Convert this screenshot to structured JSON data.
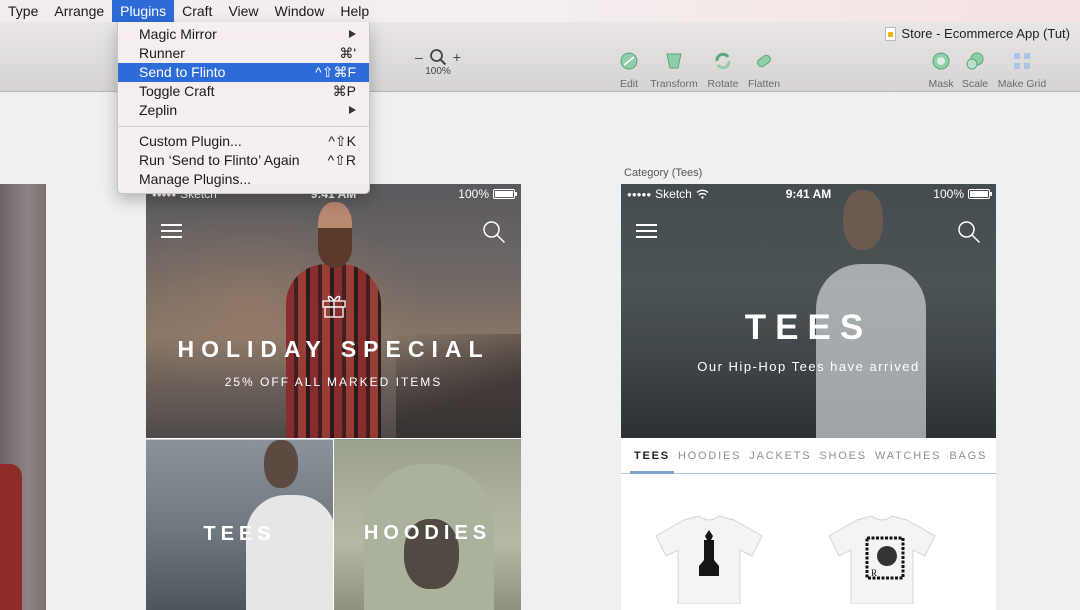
{
  "menubar": {
    "items": [
      {
        "label": "Type"
      },
      {
        "label": "Arrange"
      },
      {
        "label": "Plugins",
        "active": true
      },
      {
        "label": "Craft"
      },
      {
        "label": "View"
      },
      {
        "label": "Window"
      },
      {
        "label": "Help"
      }
    ]
  },
  "plugins_menu": {
    "items": [
      {
        "label": "Magic Mirror",
        "shortcut": "",
        "submenu": true
      },
      {
        "label": "Runner",
        "shortcut": "⌘'",
        "submenu": false
      },
      {
        "label": "Send to Flinto",
        "shortcut": "^⇧⌘F",
        "submenu": false,
        "highlighted": true
      },
      {
        "label": "Toggle Craft",
        "shortcut": "⌘P",
        "submenu": false
      },
      {
        "label": "Zeplin",
        "shortcut": "",
        "submenu": true
      }
    ],
    "items2": [
      {
        "label": "Custom Plugin...",
        "shortcut": "^⇧K"
      },
      {
        "label": "Run ‘Send to Flinto’ Again",
        "shortcut": "^⇧R"
      },
      {
        "label": "Manage Plugins...",
        "shortcut": ""
      }
    ]
  },
  "toolbar": {
    "document_title": "Store - Ecommerce App (Tut)",
    "zoom": {
      "minus": "–",
      "plus": "+",
      "level": "100%"
    },
    "tools": [
      {
        "label": "Edit",
        "icon": "edit-icon"
      },
      {
        "label": "Transform",
        "icon": "transform-icon"
      },
      {
        "label": "Rotate",
        "icon": "rotate-icon"
      },
      {
        "label": "Flatten",
        "icon": "flatten-icon"
      }
    ],
    "tools_right": [
      {
        "label": "Mask",
        "icon": "mask-icon"
      },
      {
        "label": "Scale",
        "icon": "scale-icon"
      },
      {
        "label": "Make Grid",
        "icon": "make-grid-icon"
      }
    ]
  },
  "colors": {
    "menu_highlight": "#2d6bd9",
    "tool_icon": "#7fc49a",
    "tab_underline": "#7fa3cc"
  },
  "home_artboard": {
    "status": {
      "carrier": "Sketch",
      "time": "9:41 AM",
      "battery": "100%"
    },
    "hero": {
      "title": "HOLIDAY SPECIAL",
      "subtitle": "25% OFF ALL MARKED ITEMS"
    },
    "tiles": [
      {
        "label": "TEES"
      },
      {
        "label": "HOODIES"
      }
    ]
  },
  "category_artboard": {
    "artboard_label": "Category (Tees)",
    "status": {
      "carrier": "Sketch",
      "time": "9:41 AM",
      "battery": "100%"
    },
    "hero": {
      "title": "TEES",
      "subtitle": "Our Hip-Hop Tees have arrived"
    },
    "tabs": [
      {
        "label": "TEES",
        "active": true
      },
      {
        "label": "HOODIES"
      },
      {
        "label": "JACKETS"
      },
      {
        "label": "SHOES"
      },
      {
        "label": "WATCHES"
      },
      {
        "label": "BAGS"
      }
    ]
  }
}
